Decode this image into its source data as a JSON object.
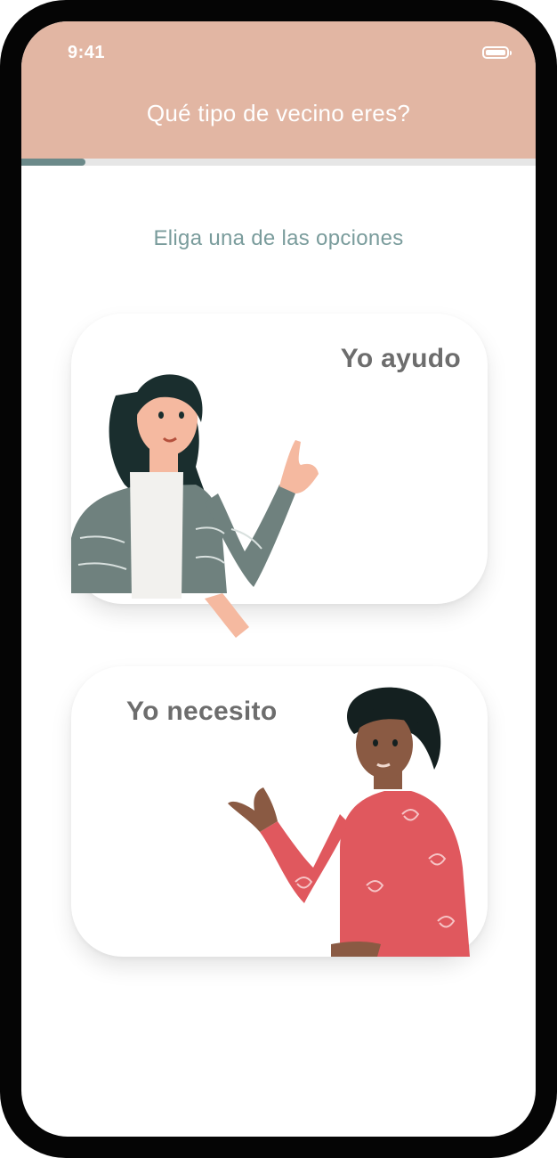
{
  "status_bar": {
    "time": "9:41",
    "battery_icon": "battery-full-icon"
  },
  "header": {
    "title": "Qué tipo de vecino eres?",
    "background": "#e2b6a3"
  },
  "progress": {
    "value": 0.125,
    "color": "#6c8a8a"
  },
  "subtitle": "Eliga una de las opciones",
  "options": [
    {
      "label": "Yo ayudo",
      "illustration": "woman-pointing-illustration"
    },
    {
      "label": "Yo necesito",
      "illustration": "man-gesturing-illustration"
    }
  ]
}
